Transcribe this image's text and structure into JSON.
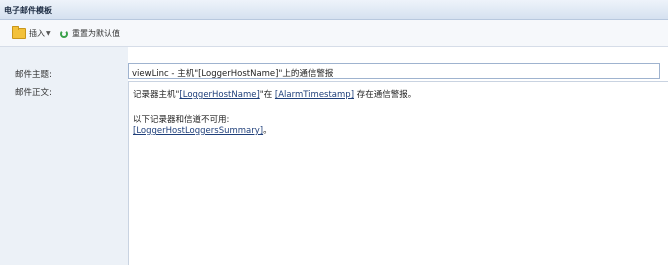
{
  "window": {
    "title": "电子邮件模板"
  },
  "toolbar": {
    "insert_label": "插入",
    "reset_label": "重置为默认值"
  },
  "form": {
    "subject_label": "邮件主题:",
    "body_label": "邮件正文:",
    "subject_value": "viewLinc - 主机\"[LoggerHostName]\"上的通信警报",
    "body": {
      "line1_a": "记录器主机\"",
      "line1_var1": "[LoggerHostName]",
      "line1_b": "\"在 ",
      "line1_var2": "[AlarmTimestamp]",
      "line1_c": " 存在通信警报。",
      "line2": "以下记录器和信道不可用:",
      "line3_var": "[LoggerHostLoggersSummary]",
      "line3_tail": "。"
    }
  }
}
